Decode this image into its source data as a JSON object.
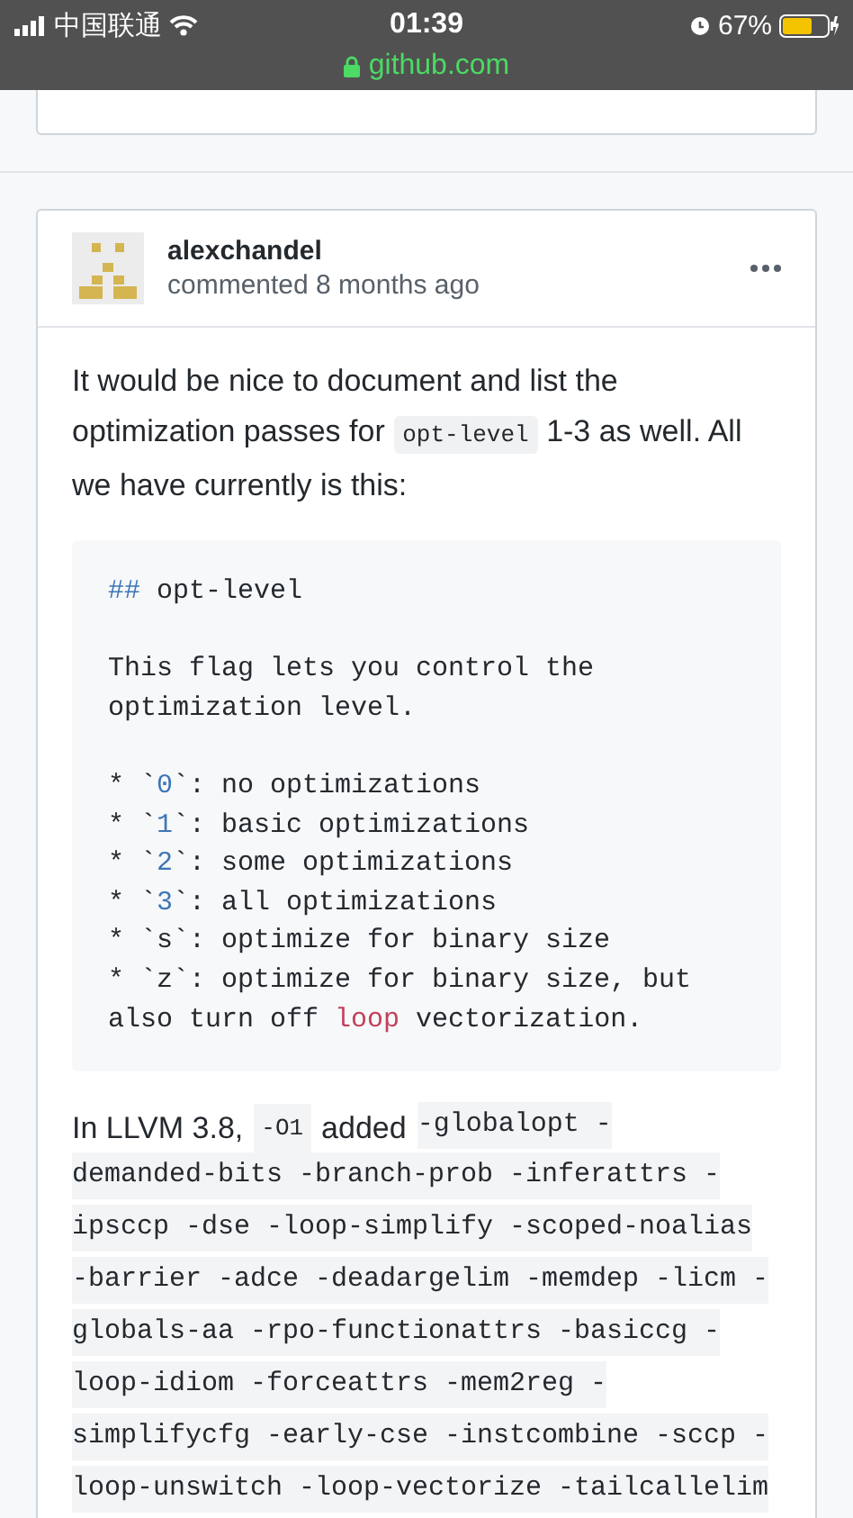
{
  "status_bar": {
    "carrier": "中国联通",
    "time": "01:39",
    "battery": "67%",
    "url": "github.com"
  },
  "comment": {
    "author": "alexchandel",
    "meta": "commented 8 months ago",
    "intro_parts": [
      {
        "kind": "text",
        "text": "It would be nice to document and list the optimization passes for"
      },
      {
        "kind": "code",
        "text": "opt-level"
      },
      {
        "kind": "text",
        "text": "1-3 as well. All we have currently is this:"
      }
    ],
    "code_block": [
      [
        [
          {
            "kind": "mark",
            "text": "##"
          },
          {
            "kind": "plain",
            "text": " opt-level"
          }
        ]
      ],
      [
        [
          {
            "kind": "plain",
            "text": "This flag lets you control the"
          }
        ],
        [
          {
            "kind": "plain",
            "text": "optimization level."
          }
        ]
      ],
      [
        [
          {
            "kind": "plain",
            "text": "* `"
          },
          {
            "kind": "number",
            "text": "0"
          },
          {
            "kind": "plain",
            "text": "`: no optimizations"
          }
        ],
        [
          {
            "kind": "plain",
            "text": "* `"
          },
          {
            "kind": "number",
            "text": "1"
          },
          {
            "kind": "plain",
            "text": "`: basic optimizations"
          }
        ],
        [
          {
            "kind": "plain",
            "text": "* `"
          },
          {
            "kind": "number",
            "text": "2"
          },
          {
            "kind": "plain",
            "text": "`: some optimizations"
          }
        ],
        [
          {
            "kind": "plain",
            "text": "* `"
          },
          {
            "kind": "number",
            "text": "3"
          },
          {
            "kind": "plain",
            "text": "`: all optimizations"
          }
        ],
        [
          {
            "kind": "plain",
            "text": "* `s`: optimize for binary size"
          }
        ],
        [
          {
            "kind": "plain",
            "text": "* `z`: optimize for binary size, but"
          }
        ],
        [
          {
            "kind": "plain",
            "text": "also turn off "
          },
          {
            "kind": "keyword",
            "text": "loop"
          },
          {
            "kind": "plain",
            "text": " vectorization."
          }
        ]
      ]
    ],
    "llvm_note": {
      "text_before": "In LLVM 3.8,",
      "flag": "-O1",
      "text_after": "added",
      "passes": [
        "-globalopt -",
        "demanded-bits -branch-prob -inferattrs -",
        "ipsccp -dse -loop-simplify -scoped-noalias",
        "-barrier -adce -deadargelim -memdep -licm -",
        "globals-aa -rpo-functionattrs -basiccg -",
        "loop-idiom -forceattrs -mem2reg -",
        "simplifycfg -early-cse -instcombine -sccp -",
        "loop-unswitch -loop-vectorize -tailcallelim"
      ]
    }
  }
}
